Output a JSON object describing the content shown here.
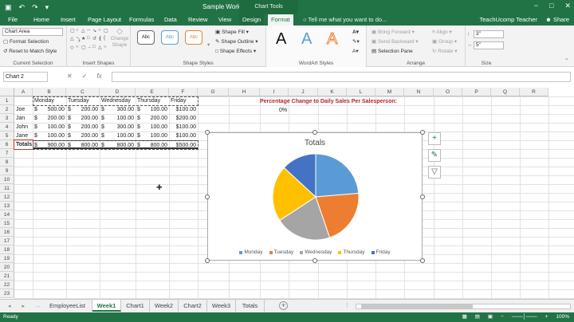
{
  "window": {
    "title": "Sample Workbook - Excel",
    "context_tab_group": "Chart Tools",
    "controls": [
      "−",
      "□",
      "✕"
    ]
  },
  "qat": {
    "save": "▣",
    "undo": "↶",
    "redo": "↷",
    "more": "▾"
  },
  "tabs": [
    "File",
    "Home",
    "Insert",
    "Page Layout",
    "Formulas",
    "Data",
    "Review",
    "View",
    "Design",
    "Format"
  ],
  "active_tab": "Format",
  "tell_me": "Tell me what you want to do...",
  "user": "TeachUcomp Teacher",
  "share": "Share",
  "ribbon": {
    "current_selection": {
      "label": "Current Selection",
      "dropdown_value": "Chart Area",
      "format_selection": "Format Selection",
      "reset_style": "Reset to Match Style"
    },
    "insert_shapes": {
      "label": "Insert Shapes",
      "change_shape": "Change Shape"
    },
    "shape_styles": {
      "label": "Shape Styles",
      "thumb_text": [
        "Abc",
        "Abc",
        "Abc"
      ],
      "fill": "Shape Fill",
      "outline": "Shape Outline",
      "effects": "Shape Effects"
    },
    "wordart": {
      "label": "WordArt Styles",
      "letters": [
        "A",
        "A",
        "A"
      ]
    },
    "arrange": {
      "label": "Arrange",
      "bring_forward": "Bring Forward",
      "send_backward": "Send Backward",
      "selection_pane": "Selection Pane",
      "align": "Align",
      "group": "Group",
      "rotate": "Rotate"
    },
    "size": {
      "label": "Size",
      "height": "3\"",
      "width": "5\""
    }
  },
  "formula_bar": {
    "name_box": "Chart 2",
    "cancel": "✕",
    "enter": "✓",
    "fx": "fx",
    "value": ""
  },
  "columns": [
    "A",
    "B",
    "C",
    "D",
    "E",
    "F",
    "G",
    "H",
    "I",
    "J",
    "K",
    "L",
    "M",
    "N",
    "O",
    "P",
    "Q",
    "R"
  ],
  "rows": [
    "1",
    "2",
    "3",
    "4",
    "5",
    "6",
    "7",
    "8",
    "9",
    "10",
    "11",
    "12",
    "13",
    "14",
    "15",
    "16",
    "17",
    "18",
    "19",
    "20",
    "21",
    "22",
    "23"
  ],
  "table": {
    "headers": [
      "Monday",
      "Tuesday",
      "Wednesday",
      "Thursday",
      "Friday"
    ],
    "rows": [
      {
        "name": "Joe",
        "values": [
          "500.00",
          "200.00",
          "300.00",
          "100.00",
          "$100.00"
        ]
      },
      {
        "name": "Jan",
        "values": [
          "200.00",
          "200.00",
          "100.00",
          "200.00",
          "$200.00"
        ]
      },
      {
        "name": "John",
        "values": [
          "100.00",
          "200.00",
          "300.00",
          "100.00",
          "$100.00"
        ]
      },
      {
        "name": "Jane",
        "values": [
          "100.00",
          "200.00",
          "100.00",
          "100.00",
          "$100.00"
        ]
      }
    ],
    "totals": {
      "name": "Totals",
      "values": [
        "900.00",
        "800.00",
        "800.00",
        "800.00",
        "$500.00"
      ]
    },
    "currency_symbol": "$"
  },
  "note": {
    "title": "Percentage Change to Daily Sales Per Salesperson:",
    "value": "0%"
  },
  "chart_data": {
    "type": "pie",
    "title": "Totals",
    "categories": [
      "Monday",
      "Tuesday",
      "Wednesday",
      "Thursday",
      "Friday"
    ],
    "values": [
      900,
      800,
      800,
      800,
      500
    ],
    "colors": [
      "#5b9bd5",
      "#ed7d31",
      "#a5a5a5",
      "#ffc000",
      "#4472c4"
    ],
    "legend_position": "bottom"
  },
  "chart_side_buttons": {
    "elements": "+",
    "styles": "✎",
    "filters": "▽"
  },
  "sheet_tabs": [
    "EmployeeList",
    "Week1",
    "Chart1",
    "Week2",
    "Chart2",
    "Week3",
    "Totals"
  ],
  "active_sheet": "Week1",
  "sheet_nav": {
    "prev": "◂",
    "next": "▸",
    "ellipsis": "...",
    "add": "+"
  },
  "status": {
    "ready": "Ready",
    "zoom": "100%"
  }
}
